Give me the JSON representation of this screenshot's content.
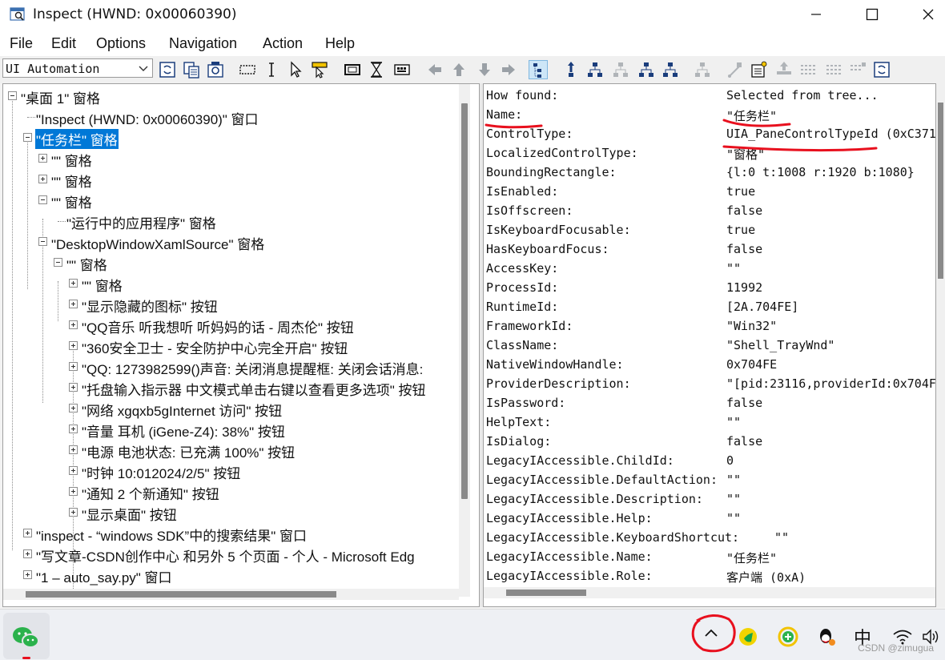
{
  "window": {
    "title": "Inspect  (HWND: 0x00060390)"
  },
  "menu": [
    "File",
    "Edit",
    "Options",
    "Navigation",
    "Action",
    "Help"
  ],
  "toolbar": {
    "mode_value": "UI Automation"
  },
  "tree": [
    {
      "label": "\"桌面 1\" 窗格",
      "expander": "minus"
    },
    {
      "label": "\"Inspect  (HWND: 0x00060390)\" 窗口",
      "expander": "none"
    },
    {
      "label": "\"任务栏\" 窗格",
      "expander": "minus",
      "selected": true
    },
    {
      "label": "\"\" 窗格",
      "expander": "plus"
    },
    {
      "label": "\"\" 窗格",
      "expander": "plus"
    },
    {
      "label": "\"\" 窗格",
      "expander": "minus"
    },
    {
      "label": "\"运行中的应用程序\" 窗格",
      "expander": "none"
    },
    {
      "label": "\"DesktopWindowXamlSource\" 窗格",
      "expander": "minus"
    },
    {
      "label": "\"\" 窗格",
      "expander": "minus"
    },
    {
      "label": "\"\" 窗格",
      "expander": "plus"
    },
    {
      "label": "\"显示隐藏的图标\" 按钮",
      "expander": "plus"
    },
    {
      "label": "\"QQ音乐 听我想听 听妈妈的话 - 周杰伦\" 按钮",
      "expander": "plus"
    },
    {
      "label": "\"360安全卫士 - 安全防护中心完全开启\" 按钮",
      "expander": "plus"
    },
    {
      "label": "\"QQ: 1273982599()声音: 关闭消息提醒框: 关闭会话消息:",
      "expander": "plus"
    },
    {
      "label": "\"托盘输入指示器 中文模式单击右键以查看更多选项\" 按钮",
      "expander": "plus"
    },
    {
      "label": "\"网络 xgqxb5gInternet 访问\" 按钮",
      "expander": "plus"
    },
    {
      "label": "\"音量 耳机 (iGene-Z4): 38%\" 按钮",
      "expander": "plus"
    },
    {
      "label": "\"电源 电池状态: 已充满 100%\" 按钮",
      "expander": "plus"
    },
    {
      "label": "\"时钟 10:012024/2/5\" 按钮",
      "expander": "plus"
    },
    {
      "label": "\"通知 2 个新通知\" 按钮",
      "expander": "plus"
    },
    {
      "label": "\"显示桌面\" 按钮",
      "expander": "plus"
    },
    {
      "label": "\"inspect - “windows SDK”中的搜索结果\" 窗口",
      "expander": "plus"
    },
    {
      "label": "\"写文章-CSDN创作中心 和另外 5 个页面 - 个人 - Microsoft Edg",
      "expander": "plus"
    },
    {
      "label": "\"1 – auto_say.py\" 窗口",
      "expander": "plus"
    }
  ],
  "properties": [
    {
      "key": "How found:",
      "value": "Selected from tree..."
    },
    {
      "key": "Name:",
      "value": "\"任务栏\""
    },
    {
      "key": "ControlType:",
      "value": "UIA_PaneControlTypeId (0xC371"
    },
    {
      "key": "LocalizedControlType:",
      "value": "\"窗格\""
    },
    {
      "key": "BoundingRectangle:",
      "value": "{l:0 t:1008 r:1920 b:1080}"
    },
    {
      "key": "IsEnabled:",
      "value": "true"
    },
    {
      "key": "IsOffscreen:",
      "value": "false"
    },
    {
      "key": "IsKeyboardFocusable:",
      "value": "true"
    },
    {
      "key": "HasKeyboardFocus:",
      "value": "false"
    },
    {
      "key": "AccessKey:",
      "value": "\"\""
    },
    {
      "key": "ProcessId:",
      "value": "11992"
    },
    {
      "key": "RuntimeId:",
      "value": "[2A.704FE]"
    },
    {
      "key": "FrameworkId:",
      "value": "\"Win32\""
    },
    {
      "key": "ClassName:",
      "value": "\"Shell_TrayWnd\""
    },
    {
      "key": "NativeWindowHandle:",
      "value": "0x704FE"
    },
    {
      "key": "ProviderDescription:",
      "value": "\"[pid:23116,providerId:0x704F"
    },
    {
      "key": "IsPassword:",
      "value": "false"
    },
    {
      "key": "HelpText:",
      "value": "\"\""
    },
    {
      "key": "IsDialog:",
      "value": "false"
    },
    {
      "key": "LegacyIAccessible.ChildId:",
      "value": "0"
    },
    {
      "key": "LegacyIAccessible.DefaultAction:",
      "value": "\"\""
    },
    {
      "key": "LegacyIAccessible.Description:",
      "value": "\"\""
    },
    {
      "key": "LegacyIAccessible.Help:",
      "value": "\"\""
    },
    {
      "key": "LegacyIAccessible.KeyboardShortcut:",
      "value": "\"\""
    },
    {
      "key": "LegacyIAccessible.Name:",
      "value": "\"任务栏\""
    },
    {
      "key": "LegacyIAccessible.Role:",
      "value": "客户端 (0xA)"
    }
  ],
  "taskbar": {
    "ime": "中",
    "watermark": "CSDN @zimugua"
  },
  "colors": {
    "selection": "#0078d7",
    "annotation": "#e8101e"
  }
}
